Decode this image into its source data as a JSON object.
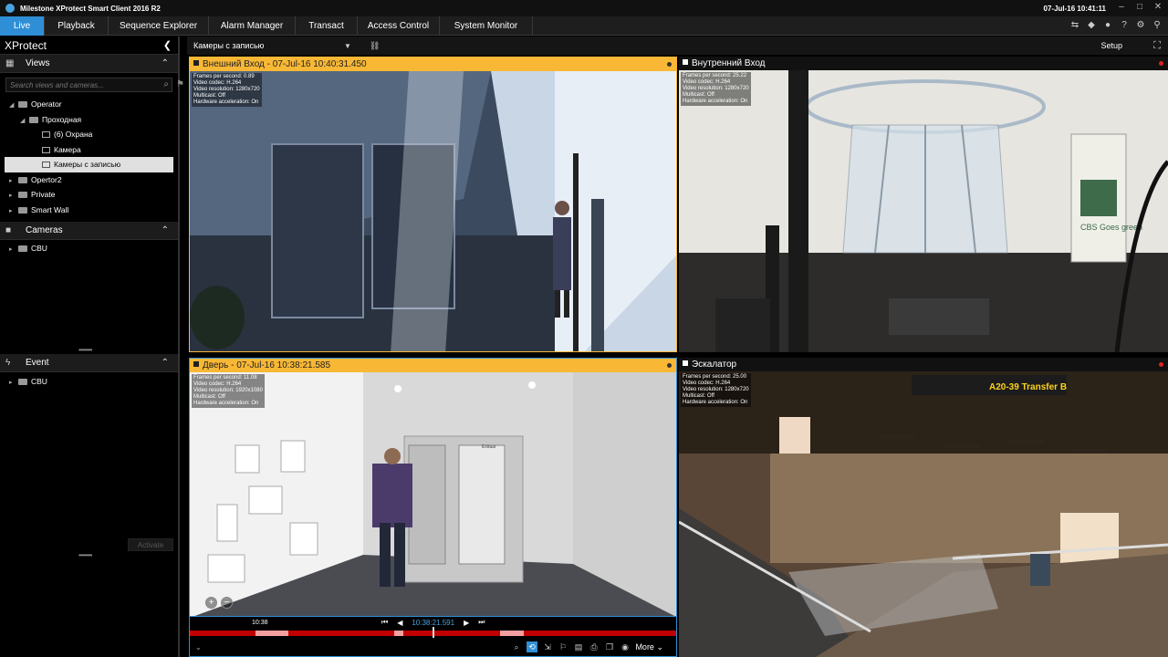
{
  "titlebar": {
    "app_title": "Milestone XProtect Smart Client 2016 R2",
    "clock": "07-Jul-16 10:41:11"
  },
  "tabs": [
    {
      "label": "Live",
      "active": true
    },
    {
      "label": "Playback"
    },
    {
      "label": "Sequence Explorer"
    },
    {
      "label": "Alarm Manager"
    },
    {
      "label": "Transact"
    },
    {
      "label": "Access Control"
    },
    {
      "label": "System Monitor"
    }
  ],
  "left": {
    "title": "XProtect",
    "views_header": "Views",
    "search_placeholder": "Search views and cameras...",
    "tree": [
      {
        "label": "Operator",
        "level": 0
      },
      {
        "label": "Проходная",
        "level": 1
      },
      {
        "label": "(6) Охрана",
        "level": 2
      },
      {
        "label": "Камера",
        "level": 2
      },
      {
        "label": "Камеры с записью",
        "level": 2,
        "selected": true
      },
      {
        "label": "Opertor2",
        "level": 0
      },
      {
        "label": "Private",
        "level": 0
      },
      {
        "label": "Smart Wall",
        "level": 0
      }
    ],
    "cameras_header": "Cameras",
    "cameras_tree": [
      {
        "label": "CBU"
      }
    ],
    "event_header": "Event",
    "event_tree": [
      {
        "label": "CBU"
      }
    ],
    "activate_label": "Activate"
  },
  "viewbar": {
    "view_name": "Камеры с записью",
    "setup_label": "Setup"
  },
  "cameras": [
    {
      "title": "Внешний Вход - 07-Jul-16 10:40:31.450",
      "recording": true,
      "stats": [
        "Frames per second: 0.89",
        "Video codec: H.264",
        "Video resolution: 1280x720",
        "Multicast: Off",
        "Hardware acceleration: On"
      ]
    },
    {
      "title": "Внутренний Вход",
      "recording": false,
      "stats": [
        "Frames per second: 25.22",
        "Video codec: H.264",
        "Video resolution: 1280x720",
        "Multicast: Off",
        "Hardware acceleration: On"
      ]
    },
    {
      "title": "Дверь - 07-Jul-16 10:38:21.585",
      "recording": true,
      "stats": [
        "Frames per second: 11.08",
        "Video codec: H.264",
        "Video resolution: 1920x1080",
        "Multicast: Off",
        "Hardware acceleration: On"
      ]
    },
    {
      "title": "Эскалатор",
      "recording": false,
      "stats": [
        "Frames per second: 25.00",
        "Video codec: H.264",
        "Video resolution: 1280x720",
        "Multicast: Off",
        "Hardware acceleration: On"
      ]
    }
  ],
  "playback": {
    "timeline_label": "10:38",
    "current_time": "10:38:21.591",
    "more_label": "More"
  },
  "scene_text": {
    "transfer_sign": "A20-39 Transfer B",
    "cbs_sign": "CBS Goes green",
    "door_sign": "Exitaar"
  }
}
